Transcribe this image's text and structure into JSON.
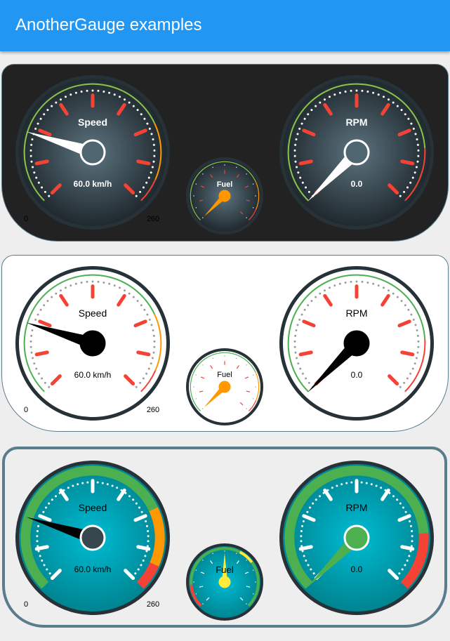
{
  "app": {
    "title": "AnotherGauge examples"
  },
  "panels": [
    {
      "id": "dark",
      "background": "#222222",
      "border": "#5b7c8d",
      "speed": {
        "label": "Speed",
        "value": 60.0,
        "unit": "km/h",
        "text": "60.0 km/h",
        "min": "0",
        "max": "260",
        "min_value": 0,
        "max_value": 260
      },
      "fuel": {
        "label": "Fuel",
        "value_fraction": 0.0
      },
      "rpm": {
        "label": "RPM",
        "value": 0.0,
        "text": "0.0"
      },
      "colors": {
        "face_center": "#5d7480",
        "face_edge": "#1e272c",
        "rim": "#263238",
        "needle": "#ffffff",
        "center_fill": "#4f6570",
        "center_stroke": "#ffffff",
        "tick_major": "#f44336",
        "tick_minor": "#ffffff",
        "text": "#ffffff",
        "fuel_needle": "#ff9800",
        "fuel_center": "#ff9800",
        "arc_low": "#8bc34a",
        "arc_mid": "#ff9800",
        "arc_high": "#f44336"
      }
    },
    {
      "id": "light",
      "background": "#ffffff",
      "border": "#5b7c8d",
      "speed": {
        "label": "Speed",
        "value": 60.0,
        "unit": "km/h",
        "text": "60.0 km/h",
        "min": "0",
        "max": "260",
        "min_value": 0,
        "max_value": 260
      },
      "fuel": {
        "label": "Fuel",
        "value_fraction": 0.0
      },
      "rpm": {
        "label": "RPM",
        "value": 0.0,
        "text": "0.0"
      },
      "colors": {
        "face_center": "#ffffff",
        "face_edge": "#ffffff",
        "rim": "#263238",
        "needle": "#000000",
        "center_fill": "#000000",
        "center_stroke": "#000000",
        "tick_major": "#f44336",
        "tick_minor": "#9e9e9e",
        "text": "#000000",
        "fuel_needle": "#ff9800",
        "fuel_center": "#ff9800",
        "arc_low": "#4caf50",
        "arc_mid": "#ff9800",
        "arc_high": "#f44336"
      }
    },
    {
      "id": "teal",
      "background": "#eeeeee",
      "border": "#5b7c8d",
      "speed": {
        "label": "Speed",
        "value": 60.0,
        "unit": "km/h",
        "text": "60.0 km/h",
        "min": "0",
        "max": "260",
        "min_value": 0,
        "max_value": 260
      },
      "fuel": {
        "label": "Fuel",
        "value_fraction": 0.5
      },
      "rpm": {
        "label": "RPM",
        "value": 0.0,
        "text": "0.0"
      },
      "colors": {
        "face_center": "#00bcd4",
        "face_edge": "#00838f",
        "rim": "#263238",
        "needle": "#000000",
        "center_fill": "#37474f",
        "center_stroke": "#ffffff",
        "tick_major": "#ffffff",
        "tick_minor": "#ffffff",
        "text": "#000000",
        "fuel_needle": "#ffeb3b",
        "fuel_center": "#ffeb3b",
        "rpm_needle": "#4caf50",
        "rpm_center": "#4caf50",
        "arc_low": "#4caf50",
        "arc_mid": "#ff9800",
        "arc_high": "#f44336"
      }
    }
  ]
}
